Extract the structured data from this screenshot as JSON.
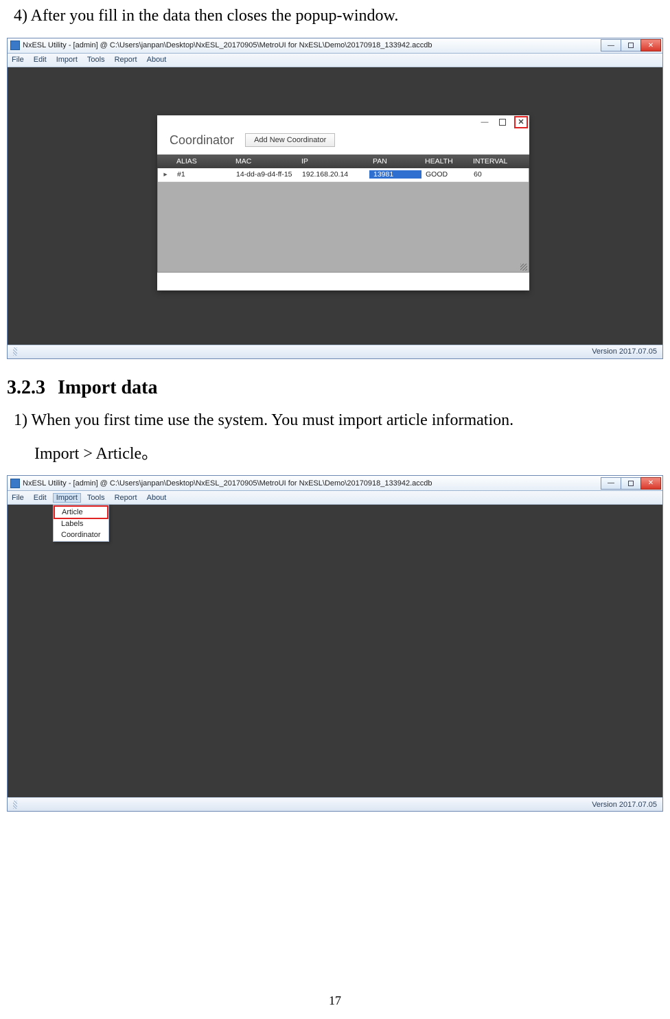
{
  "doc": {
    "step4": "4) After you fill in the data then closes the popup-window.",
    "section_num": "3.2.3",
    "section_title": "Import data",
    "step1": "1) When you first time use the system. You must import article information.",
    "step1_path": "Import > Article。",
    "page_number": "17"
  },
  "screenshot1": {
    "title": "NxESL Utility - [admin] @ C:\\Users\\janpan\\Desktop\\NxESL_20170905\\MetroUI for NxESL\\Demo\\20170918_133942.accdb",
    "menus": {
      "file": "File",
      "edit": "Edit",
      "import": "Import",
      "tools": "Tools",
      "report": "Report",
      "about": "About"
    },
    "status": "Version 2017.07.05",
    "popup": {
      "title": "Coordinator",
      "add_button": "Add New Coordinator",
      "columns": {
        "alias": "ALIAS",
        "mac": "MAC",
        "ip": "IP",
        "pan": "PAN",
        "health": "HEALTH",
        "interval": "INTERVAL"
      },
      "row": {
        "marker": "▸",
        "alias": "#1",
        "mac": "14-dd-a9-d4-ff-15",
        "ip": "192.168.20.14",
        "pan": "13981",
        "health": "GOOD",
        "interval": "60"
      }
    }
  },
  "screenshot2": {
    "title": "NxESL Utility - [admin] @ C:\\Users\\janpan\\Desktop\\NxESL_20170905\\MetroUI for NxESL\\Demo\\20170918_133942.accdb",
    "menus": {
      "file": "File",
      "edit": "Edit",
      "import": "Import",
      "tools": "Tools",
      "report": "Report",
      "about": "About"
    },
    "status": "Version 2017.07.05",
    "dropdown": {
      "article": "Article",
      "labels": "Labels",
      "coordinator": "Coordinator"
    }
  }
}
